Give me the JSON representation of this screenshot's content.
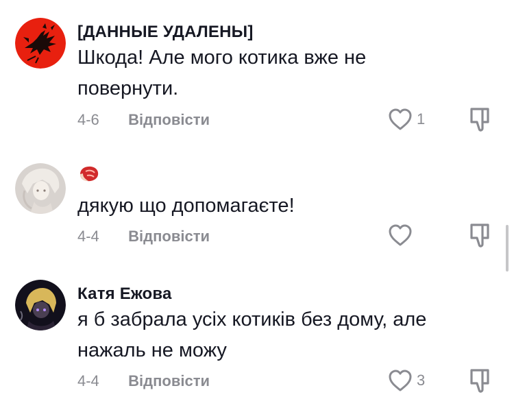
{
  "comments": [
    {
      "author": "[ДАННЫЕ УДАЛЕНЫ]",
      "text_lines": [
        "Шкода! Але мого котика вже не",
        "повернути."
      ],
      "date": "4-6",
      "reply_label": "Відповісти",
      "like_count": "1",
      "avatar_icon": "red-dragon-avatar"
    },
    {
      "author_icon": "meat-emoji",
      "text_lines": [
        "дякую що допомагаєте!"
      ],
      "date": "4-4",
      "reply_label": "Відповісти",
      "like_count": "",
      "avatar_icon": "anime-girl-avatar"
    },
    {
      "author": "Катя Ежова",
      "text_lines": [
        "я б забрала усіх котиків без дому, але",
        "нажаль не можу"
      ],
      "date": "4-4",
      "reply_label": "Відповісти",
      "like_count": "3",
      "avatar_icon": "dark-anime-avatar"
    }
  ],
  "icons": {
    "like": "heart-outline-icon",
    "dislike": "thumbs-down-outline-icon"
  },
  "colors": {
    "text": "#161823",
    "secondary": "#8a8b91",
    "avatar_red": "#e8200f"
  }
}
